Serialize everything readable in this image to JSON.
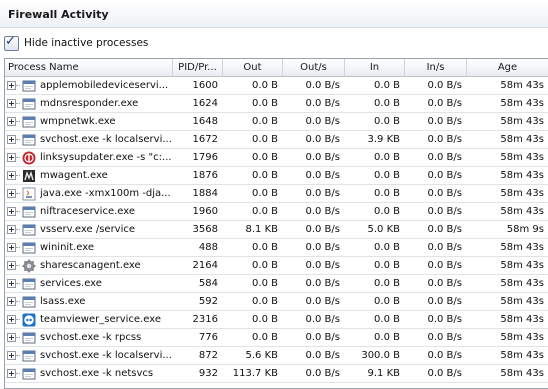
{
  "title": "Firewall Activity",
  "hide_inactive": {
    "label": "Hide inactive processes",
    "checked": true
  },
  "columns": [
    "Process Name",
    "PID/Pr...",
    "Out",
    "Out/s",
    "In",
    "In/s",
    "Age"
  ],
  "rows": [
    {
      "icon": "exe-icon",
      "name": "applemobiledeviceservi...",
      "pid": "1600",
      "out": "0.0  B",
      "outs": "0.0  B/s",
      "in": "0.0  B",
      "ins": "0.0  B/s",
      "age": "58m 43s"
    },
    {
      "icon": "exe-icon",
      "name": "mdnsresponder.exe",
      "pid": "1624",
      "out": "0.0  B",
      "outs": "0.0  B/s",
      "in": "0.0  B",
      "ins": "0.0  B/s",
      "age": "58m 43s"
    },
    {
      "icon": "exe-icon",
      "name": "wmpnetwk.exe",
      "pid": "1648",
      "out": "0.0  B",
      "outs": "0.0  B/s",
      "in": "0.0  B",
      "ins": "0.0  B/s",
      "age": "58m 43s"
    },
    {
      "icon": "exe-icon",
      "name": "svchost.exe -k localservi...",
      "pid": "1672",
      "out": "0.0  B",
      "outs": "0.0  B/s",
      "in": "3.9  KB",
      "ins": "0.0  B/s",
      "age": "58m 43s"
    },
    {
      "icon": "linksys-icon",
      "name": "linksysupdater.exe -s \"c:...",
      "pid": "1796",
      "out": "0.0  B",
      "outs": "0.0  B/s",
      "in": "0.0  B",
      "ins": "0.0  B/s",
      "age": "58m 43s"
    },
    {
      "icon": "mwagent-icon",
      "name": "mwagent.exe",
      "pid": "1876",
      "out": "0.0  B",
      "outs": "0.0  B/s",
      "in": "0.0  B",
      "ins": "0.0  B/s",
      "age": "58m 43s"
    },
    {
      "icon": "java-icon",
      "name": "java.exe -xmx100m -dja...",
      "pid": "1884",
      "out": "0.0  B",
      "outs": "0.0  B/s",
      "in": "0.0  B",
      "ins": "0.0  B/s",
      "age": "58m 43s"
    },
    {
      "icon": "exe-icon",
      "name": "niftraceservice.exe",
      "pid": "1960",
      "out": "0.0  B",
      "outs": "0.0  B/s",
      "in": "0.0  B",
      "ins": "0.0  B/s",
      "age": "58m 43s"
    },
    {
      "icon": "exe-icon",
      "name": "vsserv.exe /service",
      "pid": "3568",
      "out": "8.1  KB",
      "outs": "0.0  B/s",
      "in": "5.0  KB",
      "ins": "0.0  B/s",
      "age": "58m 9s"
    },
    {
      "icon": "exe-icon",
      "name": "wininit.exe",
      "pid": "488",
      "out": "0.0  B",
      "outs": "0.0  B/s",
      "in": "0.0  B",
      "ins": "0.0  B/s",
      "age": "58m 43s"
    },
    {
      "icon": "gear-icon",
      "name": "sharescanagent.exe",
      "pid": "2164",
      "out": "0.0  B",
      "outs": "0.0  B/s",
      "in": "0.0  B",
      "ins": "0.0  B/s",
      "age": "58m 43s"
    },
    {
      "icon": "exe-icon",
      "name": "services.exe",
      "pid": "584",
      "out": "0.0  B",
      "outs": "0.0  B/s",
      "in": "0.0  B",
      "ins": "0.0  B/s",
      "age": "58m 43s"
    },
    {
      "icon": "exe-icon",
      "name": "lsass.exe",
      "pid": "592",
      "out": "0.0  B",
      "outs": "0.0  B/s",
      "in": "0.0  B",
      "ins": "0.0  B/s",
      "age": "58m 43s"
    },
    {
      "icon": "teamviewer-icon",
      "name": "teamviewer_service.exe",
      "pid": "2316",
      "out": "0.0  B",
      "outs": "0.0  B/s",
      "in": "0.0  B",
      "ins": "0.0  B/s",
      "age": "58m 43s"
    },
    {
      "icon": "exe-icon",
      "name": "svchost.exe -k rpcss",
      "pid": "776",
      "out": "0.0  B",
      "outs": "0.0  B/s",
      "in": "0.0  B",
      "ins": "0.0  B/s",
      "age": "58m 43s"
    },
    {
      "icon": "exe-icon",
      "name": "svchost.exe -k localservi...",
      "pid": "872",
      "out": "5.6  KB",
      "outs": "0.0  B/s",
      "in": "300.0  B",
      "ins": "0.0  B/s",
      "age": "58m 43s"
    },
    {
      "icon": "exe-icon",
      "name": "svchost.exe -k netsvcs",
      "pid": "932",
      "out": "113.7  KB",
      "outs": "0.0  B/s",
      "in": "9.1  KB",
      "ins": "0.0  B/s",
      "age": "58m 43s"
    }
  ],
  "colors": {
    "header_bg": "#e9ecf0",
    "border": "#9aa3ad",
    "linksys": "#c0282d",
    "teamviewer": "#1a73c7",
    "java": "#e06b1a"
  }
}
